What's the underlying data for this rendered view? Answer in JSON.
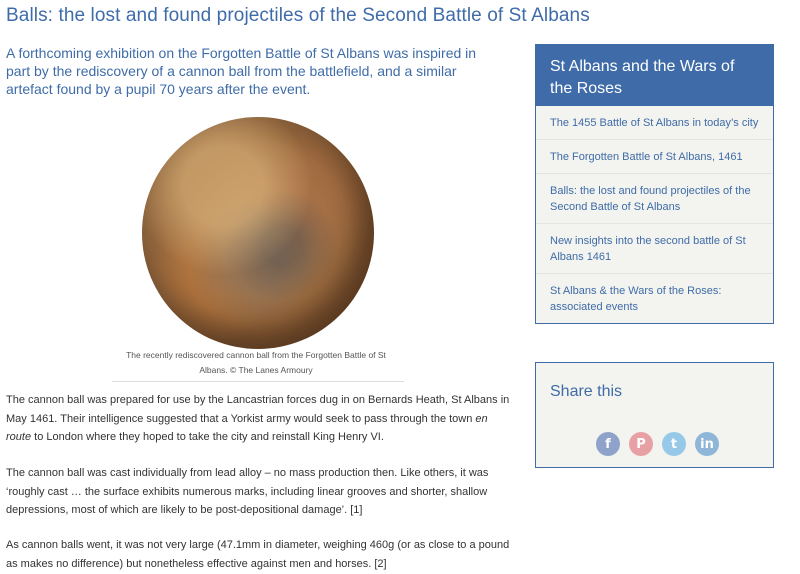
{
  "article": {
    "title": "Balls: the lost and found projectiles of the Second Battle of St Albans",
    "lead": "A forthcoming exhibition on the Forgotten Battle of St Albans was inspired in part by the rediscovery of a cannon ball from the battlefield, and a similar artefact found by a pupil 70 years after the event.",
    "caption_line1": "The recently rediscovered cannon ball from the Forgotten Battle of St",
    "caption_line2": "Albans. © The Lanes Armoury",
    "p1_before": "The cannon ball was prepared for use by the Lancastrian forces dug in on Bernards Heath, St Albans in May 1461. Their intelligence suggested that a Yorkist army would seek to pass through the town ",
    "p1_em": "en route",
    "p1_after": " to London where they hoped to take the city and reinstall King Henry VI.",
    "p2": "The cannon ball was cast individually from lead alloy – no mass production then. Like others, it was ‘roughly cast … the surface exhibits numerous marks, including linear grooves and shorter, shallow depressions, most of which are likely to be post-depositional damage’. [1]",
    "p3": "As cannon balls went, it was not very large (47.1mm in diameter, weighing 460g (or as close to a pound as makes no difference) but nonetheless effective against men and horses. [2]"
  },
  "sidebar": {
    "heading": "St Albans and the Wars of the Roses",
    "items": [
      {
        "label": "The 1455 Battle of St Albans in today’s city"
      },
      {
        "label": "The Forgotten Battle of St Albans, 1461"
      },
      {
        "label": "Balls: the lost and found projectiles of the Second Battle of St Albans"
      },
      {
        "label": "New insights into the second battle of St Albans 1461"
      },
      {
        "label": "St Albans & the Wars of the Roses: associated events"
      }
    ]
  },
  "share": {
    "title": "Share this",
    "icons": [
      {
        "name": "facebook-icon",
        "glyph": "f",
        "color": "#8fa2c9"
      },
      {
        "name": "pinterest-icon",
        "glyph": "P",
        "color": "#e7a0a4"
      },
      {
        "name": "twitter-icon",
        "glyph": "t",
        "color": "#96c9e8"
      },
      {
        "name": "linkedin-icon",
        "glyph": "in",
        "color": "#8fb6d6"
      }
    ]
  },
  "colors": {
    "accent": "#3f6ca8",
    "sidebar_bg": "#f3f3ef",
    "body_text": "#333333"
  }
}
